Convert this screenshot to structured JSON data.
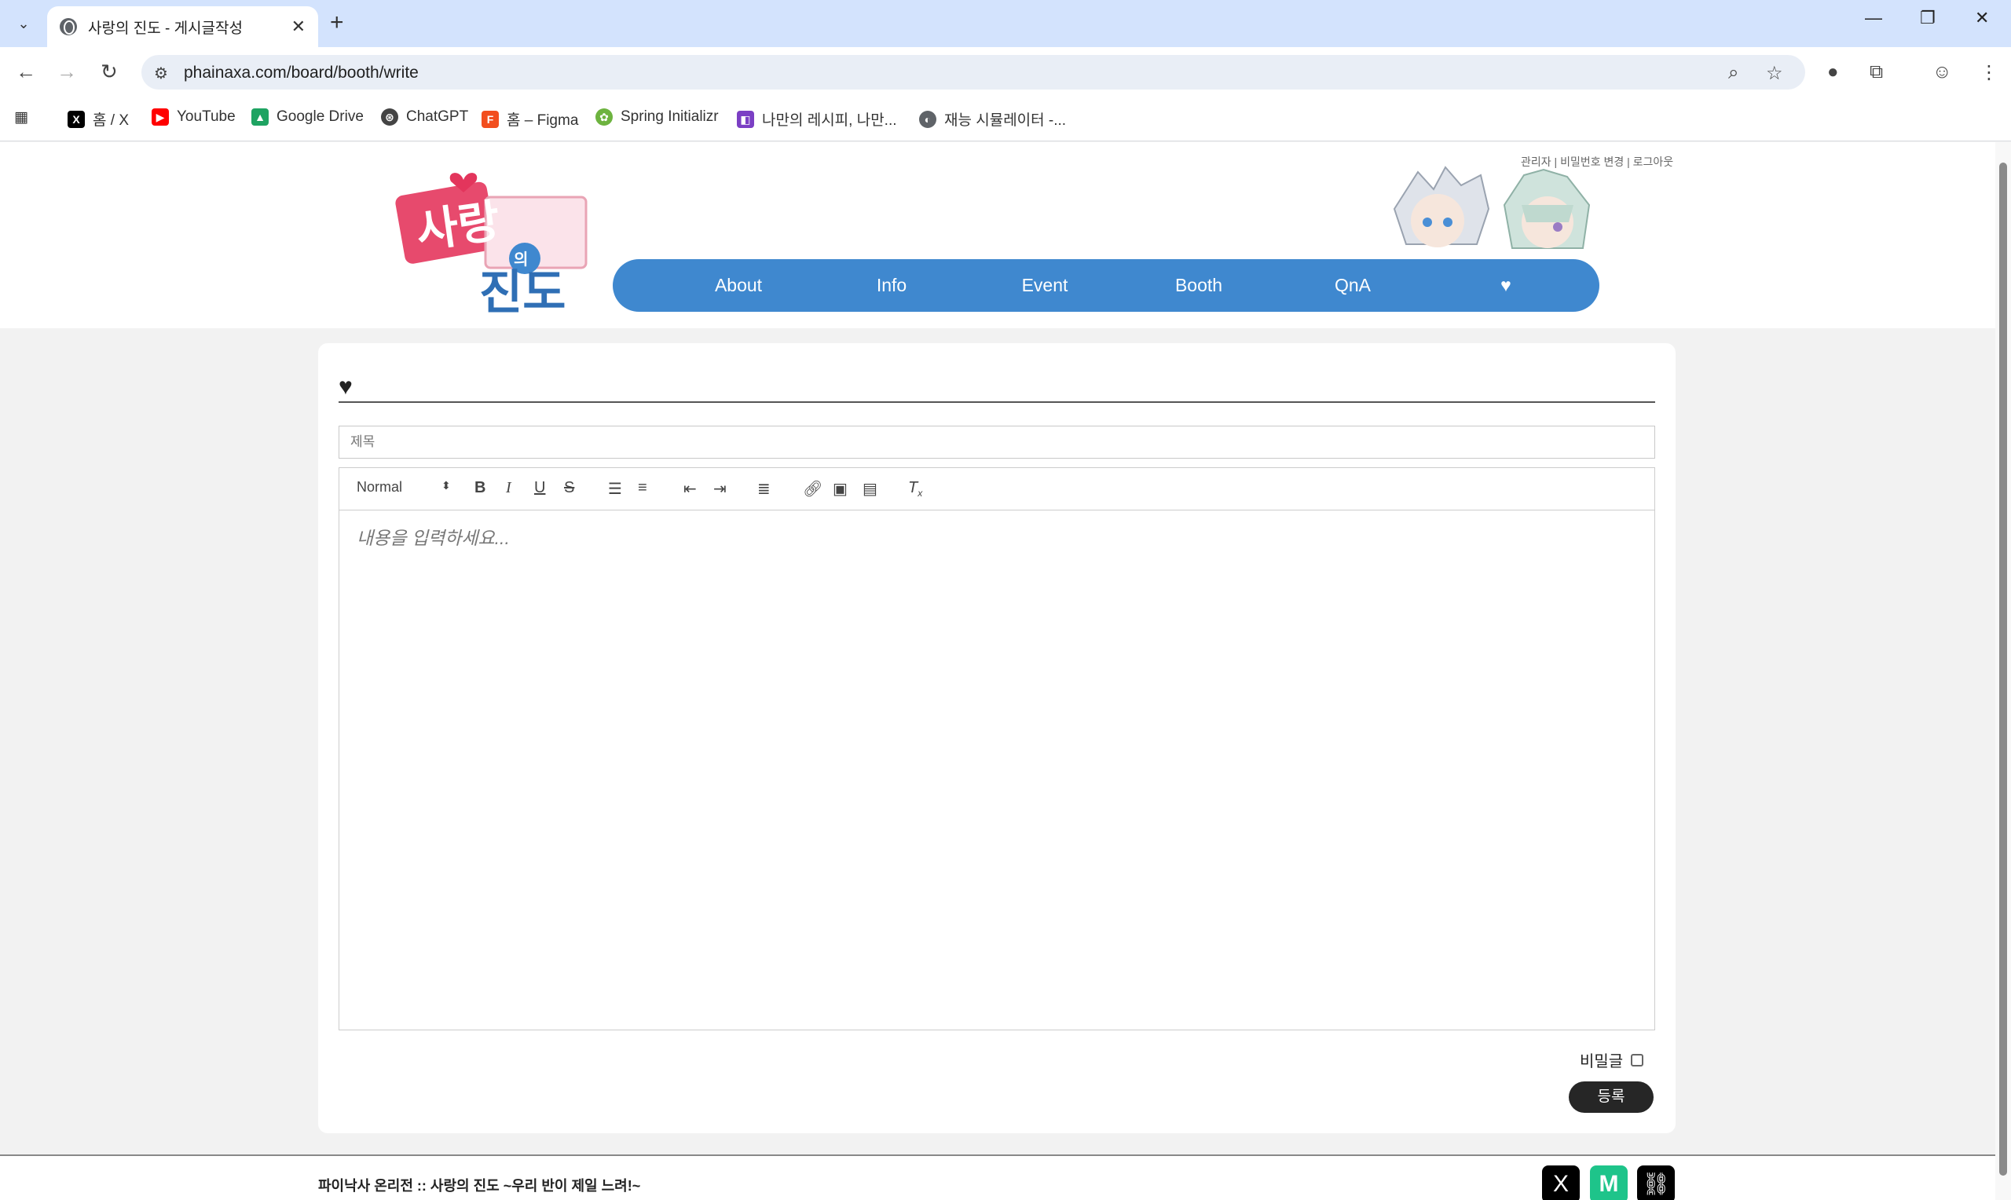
{
  "browser": {
    "tab_title": "사랑의 진도 - 게시글작성",
    "url": "phainaxa.com/board/booth/write",
    "bookmarks": [
      "홈 / X",
      "YouTube",
      "Google Drive",
      "ChatGPT",
      "홈 – Figma",
      "Spring Initializr",
      "나만의 레시피, 나만...",
      "재능 시뮬레이터 -..."
    ]
  },
  "header": {
    "top_links": [
      "관리자",
      "비밀번호 변경",
      "로그아웃"
    ],
    "nav": [
      "About",
      "Info",
      "Event",
      "Booth",
      "QnA"
    ],
    "logo_text": "사랑의 진도"
  },
  "form": {
    "heading_icon": "heart-icon",
    "subject_placeholder": "제목",
    "format_select": "Normal",
    "editor_placeholder": "내용을 입력하세요...",
    "secret_label": "비밀글",
    "submit_label": "등록"
  },
  "footer": {
    "text": "파이낙사 온리전 :: 사랑의 진도 ~우리 반이 제일 느려!~"
  },
  "colors": {
    "nav_bg": "#3f88cf",
    "tab_bar_bg": "#d3e3fd",
    "submit_bg": "#262626"
  }
}
